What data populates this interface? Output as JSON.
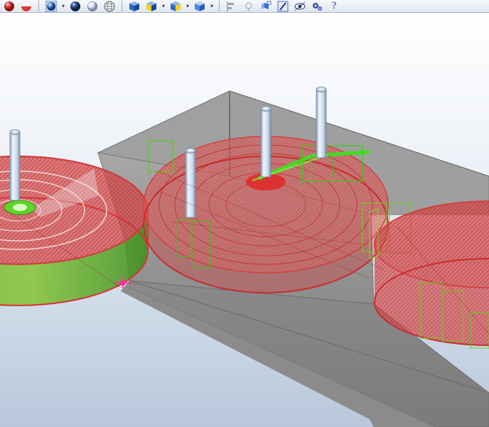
{
  "toolbar": {
    "help_glyph": "?",
    "groups": [
      [
        "red-sphere-icon",
        "red-half-sphere-icon"
      ],
      [
        "shaded-sphere-icon",
        "dark-sphere-icon",
        "light-sphere-icon",
        "wireframe-sphere-icon"
      ],
      [
        "blue-cube-icon",
        "yellow-cube-icon",
        "yellow-side-cube-icon",
        "blue-side-cube-icon"
      ],
      [
        "align-icon",
        "node-icon",
        "cube-edit-icon",
        "pen-icon",
        "eye-icon",
        "gears-icon",
        "help-icon"
      ]
    ]
  },
  "scene": {
    "description_colors": {
      "slab": "#9b9b9b",
      "tank_mesh": "#d32f2f",
      "highlight": "#61d61d",
      "pipe": "#c9d9ea",
      "background_top": "#ffffff",
      "background_bottom": "#b9c7db"
    }
  }
}
